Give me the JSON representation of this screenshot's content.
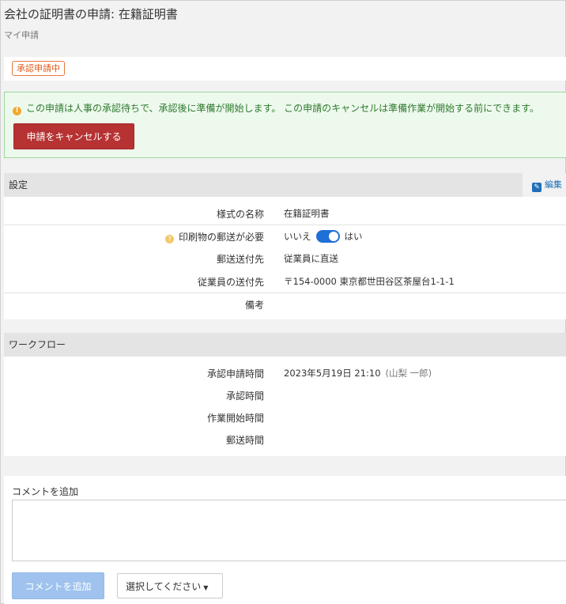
{
  "header": {
    "title": "会社の証明書の申請: 在籍証明書",
    "breadcrumb": "マイ申請"
  },
  "status": {
    "badge": "承認申請中",
    "accent_color": "#e05a18"
  },
  "alert": {
    "icon": "info-icon",
    "message": "この申請は人事の承認待ちで、承認後に準備が開始します。 この申請のキャンセルは準備作業が開始する前にできます。",
    "cancel_label": "申請をキャンセルする"
  },
  "settings": {
    "section_title": "設定",
    "edit_label": "編集",
    "rows": {
      "form_name": {
        "label": "様式の名称",
        "value": "在籍証明書"
      },
      "mail_required": {
        "label": "印刷物の郵送が必要",
        "off_label": "いいえ",
        "on_label": "はい",
        "enabled": true
      },
      "mail_dest": {
        "label": "郵送送付先",
        "value": "従業員に直送"
      },
      "employee_dest": {
        "label": "従業員の送付先",
        "value": "〒154-0000 東京都世田谷区茶屋台1-1-1"
      },
      "notes": {
        "label": "備考",
        "value": ""
      }
    }
  },
  "workflow": {
    "section_title": "ワークフロー",
    "rows": {
      "request_time": {
        "label": "承認申請時間",
        "value": "2023年5月19日 21:10",
        "by": "(山梨 一郎)"
      },
      "approve_time": {
        "label": "承認時間",
        "value": ""
      },
      "start_time": {
        "label": "作業開始時間",
        "value": ""
      },
      "mail_time": {
        "label": "郵送時間",
        "value": ""
      }
    }
  },
  "comment": {
    "label": "コメントを追加",
    "value": "",
    "submit_label": "コメントを追加",
    "select_label": "選択してください"
  }
}
